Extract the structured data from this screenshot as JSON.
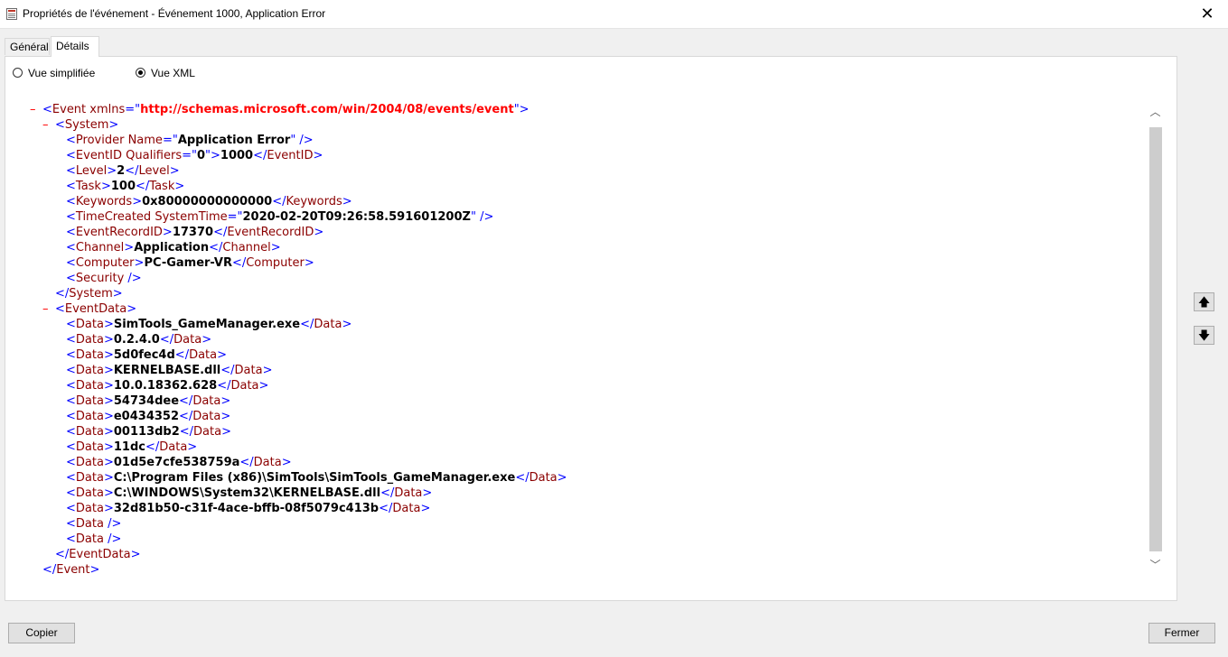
{
  "window": {
    "title": "Propriétés de l'événement - Événement 1000, Application Error",
    "close_glyph": "✕"
  },
  "tabs": [
    {
      "label": "Général",
      "active": false
    },
    {
      "label": "Détails",
      "active": true
    }
  ],
  "view_mode": {
    "options": [
      {
        "label": "Vue simplifiée",
        "selected": false
      },
      {
        "label": "Vue XML",
        "selected": true
      }
    ]
  },
  "xml": {
    "collapse_glyph": "–",
    "event": {
      "open_tag": "Event",
      "attr_name": "xmlns",
      "attr_value": "http://schemas.microsoft.com/win/2004/08/events/event",
      "close_tag": "Event"
    },
    "system": {
      "tag": "System",
      "provider": {
        "tag": "Provider",
        "attr": "Name",
        "value": "Application Error"
      },
      "event_id": {
        "tag": "EventID",
        "attr": "Qualifiers",
        "attr_value": "0",
        "value": "1000"
      },
      "level": {
        "tag": "Level",
        "value": "2"
      },
      "task": {
        "tag": "Task",
        "value": "100"
      },
      "keywords": {
        "tag": "Keywords",
        "value": "0x80000000000000"
      },
      "time_created": {
        "tag": "TimeCreated",
        "attr": "SystemTime",
        "value": "2020-02-20T09:26:58.591601200Z"
      },
      "event_record_id": {
        "tag": "EventRecordID",
        "value": "17370"
      },
      "channel": {
        "tag": "Channel",
        "value": "Application"
      },
      "computer": {
        "tag": "Computer",
        "value": "PC-Gamer-VR"
      },
      "security": {
        "tag": "Security"
      }
    },
    "event_data": {
      "tag": "EventData",
      "data_tag": "Data",
      "items": [
        "SimTools_GameManager.exe",
        "0.2.4.0",
        "5d0fec4d",
        "KERNELBASE.dll",
        "10.0.18362.628",
        "54734dee",
        "e0434352",
        "00113db2",
        "11dc",
        "01d5e7cfe538759a",
        "C:\\Program Files (x86)\\SimTools\\SimTools_GameManager.exe",
        "C:\\WINDOWS\\System32\\KERNELBASE.dll",
        "32d81b50-c31f-4ace-bffb-08f5079c413b"
      ],
      "empty_items": 2
    }
  },
  "side_buttons": {
    "up_glyph": "🡅",
    "down_glyph": "🡇"
  },
  "scrollbar": {
    "up_glyph": "︿",
    "down_glyph": "﹀"
  },
  "buttons": {
    "copy": "Copier",
    "close": "Fermer"
  }
}
